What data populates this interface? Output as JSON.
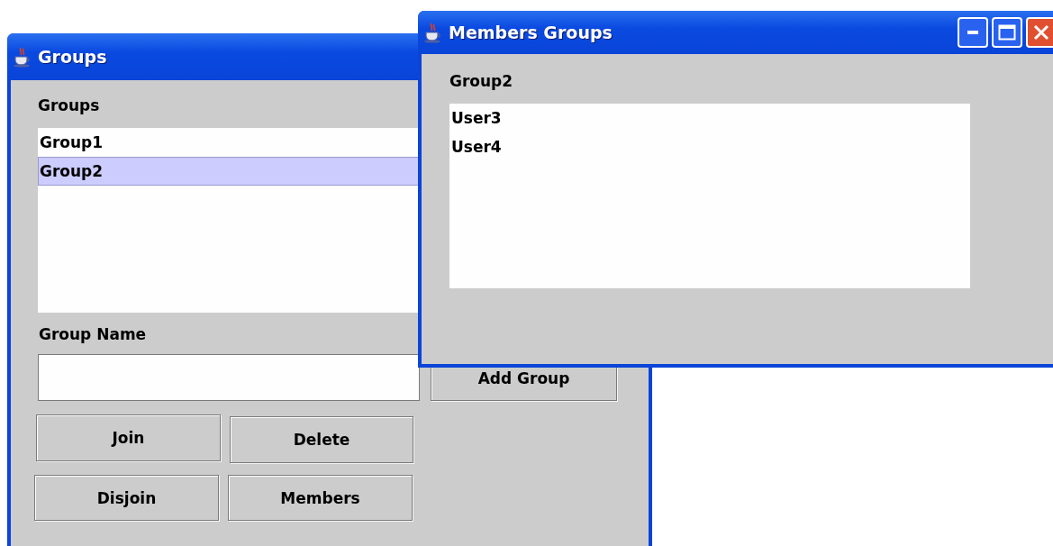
{
  "groups_window": {
    "title": "Groups",
    "list_label": "Groups",
    "groups": [
      {
        "label": "Group1",
        "selected": false
      },
      {
        "label": "Group2",
        "selected": true
      }
    ],
    "name_label": "Group Name",
    "buttons": [
      "Add Group",
      "Join",
      "Delete",
      "Disjoin",
      "Members"
    ]
  },
  "members_window": {
    "title": "Members Groups",
    "group_label": "Group2",
    "members": [
      {
        "label": "User3",
        "selected": false
      },
      {
        "label": "User4",
        "selected": false
      }
    ]
  }
}
